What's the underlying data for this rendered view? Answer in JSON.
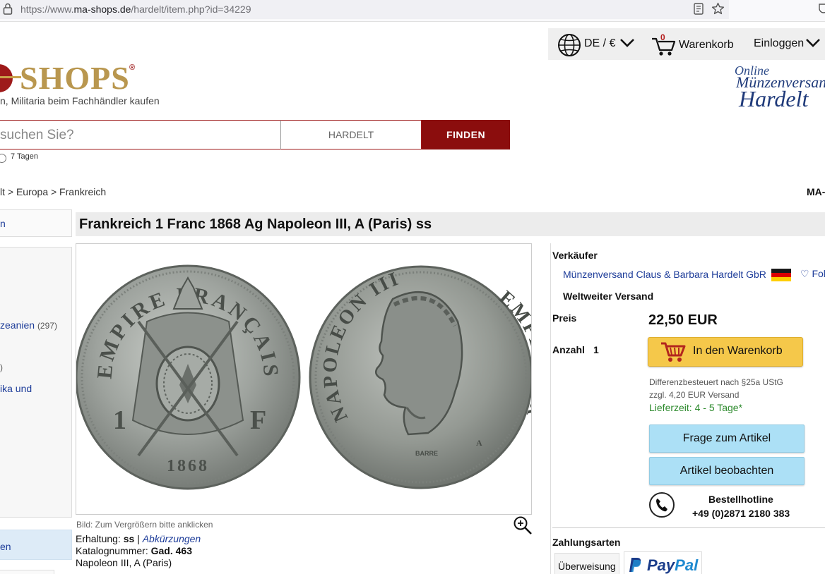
{
  "browser": {
    "url_prefix": "https://www.",
    "url_domain": "ma-shops.de",
    "url_path": "/hardelt/item.php?id=34229"
  },
  "header": {
    "locale": "DE / €",
    "cart_count": "0",
    "cart_label": "Warenkorb",
    "login_label": "Einloggen"
  },
  "logo": {
    "brand": "SHOPS",
    "tagline": "n, Militaria beim Fachhändler kaufen"
  },
  "seller_logo": {
    "line1": "Online",
    "line2": "Münzenversand",
    "line3": "Hardelt"
  },
  "search": {
    "placeholder": "suchen Sie?",
    "scope": "HARDELT",
    "button": "FINDEN",
    "radio_label": "7 Tagen"
  },
  "breadcrumb": "lt > Europa > Frankreich",
  "top_right_label": "MA-",
  "sidebar": {
    "item_top": "n",
    "link1": "zeanien",
    "link1_count": "(297)",
    "paren": ")",
    "link2": "ika und",
    "bottom_item": "en"
  },
  "item": {
    "title": "Frankreich 1 Franc 1868 Ag Napoleon III, A (Paris) ss",
    "image_caption": "Bild: Zum Vergrößern bitte anklicken",
    "condition_label": "Erhaltung:",
    "condition_value": "ss",
    "condition_sep": "|",
    "abbrev_link": "Abkürzungen",
    "catalog_label": "Katalognummer:",
    "catalog_value": "Gad. 463",
    "description": "Napoleon III, A (Paris)"
  },
  "coin": {
    "obverse_legend": "EMPIRE FRANÇAIS",
    "obverse_value_left": "1",
    "obverse_value_right": "F",
    "obverse_year": "1868",
    "reverse_legend_left": "NAPOLEON III",
    "reverse_legend_right": "EMPEREUR",
    "engraver": "BARRE",
    "mint_mark": "A"
  },
  "panel": {
    "seller_label": "Verkäufer",
    "seller_name": "Münzenversand Claus & Barbara Hardelt GbR",
    "follow": "♡ Fol",
    "shipping": "Weltweiter Versand",
    "price_label": "Preis",
    "price": "22,50 EUR",
    "qty_label": "Anzahl",
    "qty": "1",
    "add_to_cart": "In den Warenkorb",
    "tax_note": "Differenzbesteuert nach §25a UStG",
    "shipping_note": "zzgl. 4,20 EUR Versand",
    "delivery": "Lieferzeit: 4 - 5 Tage*",
    "ask_button": "Frage zum Artikel",
    "watch_button": "Artikel beobachten",
    "hotline_title": "Bestellhotline",
    "hotline_number": "+49 (0)2871 2180 383",
    "payment_label": "Zahlungsarten",
    "payment_transfer": "Überweisung",
    "paypal_pay": "Pay",
    "paypal_pal": "Pal"
  }
}
